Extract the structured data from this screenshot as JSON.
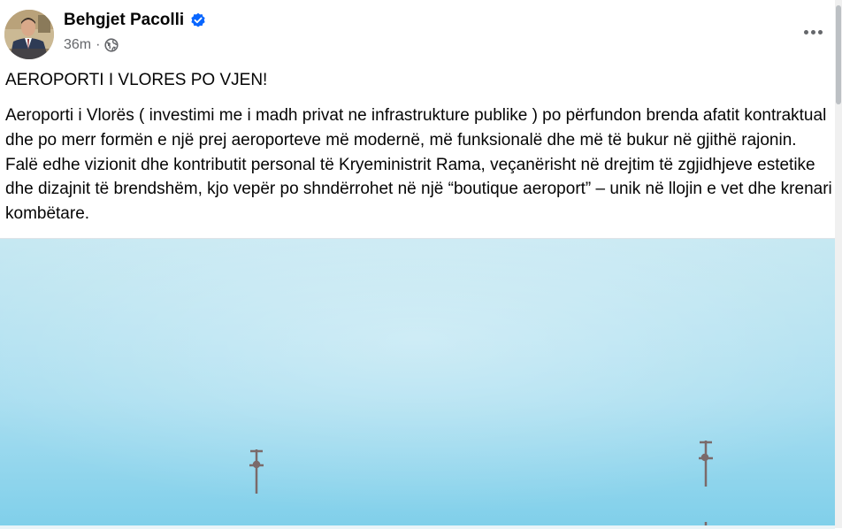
{
  "post": {
    "author": "Behgjet Pacolli",
    "timestamp": "36m",
    "separator": "·",
    "privacy_icon": "globe-icon",
    "verified_icon": "verified-badge-icon",
    "more_icon": "more-options-icon",
    "title": "AEROPORTI I VLORES PO VJEN!",
    "body": "Aeroporti i Vlorës ( investimi me i madh privat ne infrastrukture publike ) po përfundon brenda afatit kontraktual dhe po merr formën e një prej aeroporteve më modernë, më funksionalë dhe më të bukur në gjithë rajonin. Falë edhe vizionit dhe kontributit personal të Kryeministrit Rama, veçanërisht në drejtim të zgjidhjeve estetike dhe dizajnit të brendshëm, kjo vepër po shndërrohet në një “boutique aeroport” – unik në llojin e vet dhe krenari kombëtare."
  },
  "colors": {
    "verified_blue": "#0866ff",
    "secondary_text": "#65676b",
    "sky_top": "#bfe6f1",
    "sky_bottom": "#7fd0ea"
  }
}
